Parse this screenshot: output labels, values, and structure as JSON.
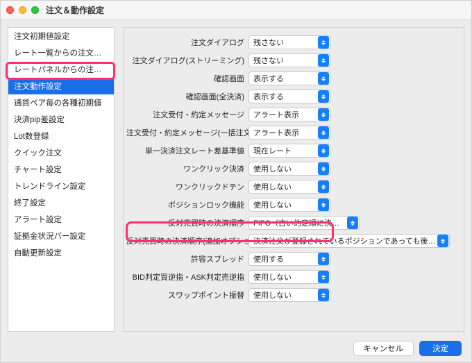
{
  "window": {
    "title": "注文＆動作設定"
  },
  "sidebar": {
    "items": [
      {
        "label": "注文初期値設定"
      },
      {
        "label": "レート一覧からの注文方法"
      },
      {
        "label": "レートパネルからの注文方法"
      },
      {
        "label": "注文動作設定",
        "selected": true
      },
      {
        "label": "通貨ペア毎の各種初期値"
      },
      {
        "label": "決済pip差設定"
      },
      {
        "label": "Lot数登録"
      },
      {
        "label": "クイック注文"
      },
      {
        "label": "チャート設定"
      },
      {
        "label": "トレンドライン設定"
      },
      {
        "label": "終了設定"
      },
      {
        "label": "アラート設定"
      },
      {
        "label": "証拠金状況バー設定"
      },
      {
        "label": "自動更新設定"
      }
    ]
  },
  "rows": [
    {
      "label": "注文ダイアログ",
      "value": "残さない",
      "w": ""
    },
    {
      "label": "注文ダイアログ(ストリーミング)",
      "value": "残さない",
      "w": ""
    },
    {
      "label": "確認画面",
      "value": "表示する",
      "w": ""
    },
    {
      "label": "確認画面(全決済)",
      "value": "表示する",
      "w": ""
    },
    {
      "label": "注文受付・約定メッセージ",
      "value": "アラート表示",
      "w": ""
    },
    {
      "label": "注文受付・約定メッセージ(一括注文)",
      "value": "アラート表示",
      "w": ""
    },
    {
      "label": "単一決済注文レート差基準値",
      "value": "現在レート",
      "w": ""
    },
    {
      "label": "ワンクリック決済",
      "value": "使用しない",
      "w": ""
    },
    {
      "label": "ワンクリックドテン",
      "value": "使用しない",
      "w": ""
    },
    {
      "label": "ポジションロック機能",
      "value": "使用しない",
      "w": ""
    },
    {
      "label": "反対売買時の決済順序",
      "value": "FIFO（古い約定順に決済）",
      "w": "mid"
    },
    {
      "label": "反対売買時の決済順序(追加オプション)",
      "value": "決済注文が登録されているポジションであっても後回ししない",
      "w": "wide"
    },
    {
      "label": "許容スプレッド",
      "value": "使用する",
      "w": "",
      "hl": true
    },
    {
      "label": "BID判定買逆指・ASK判定売逆指",
      "value": "使用しない",
      "w": ""
    },
    {
      "label": "スワップポイント振替",
      "value": "使用しない",
      "w": ""
    }
  ],
  "footer": {
    "cancel": "キャンセル",
    "ok": "決定"
  }
}
